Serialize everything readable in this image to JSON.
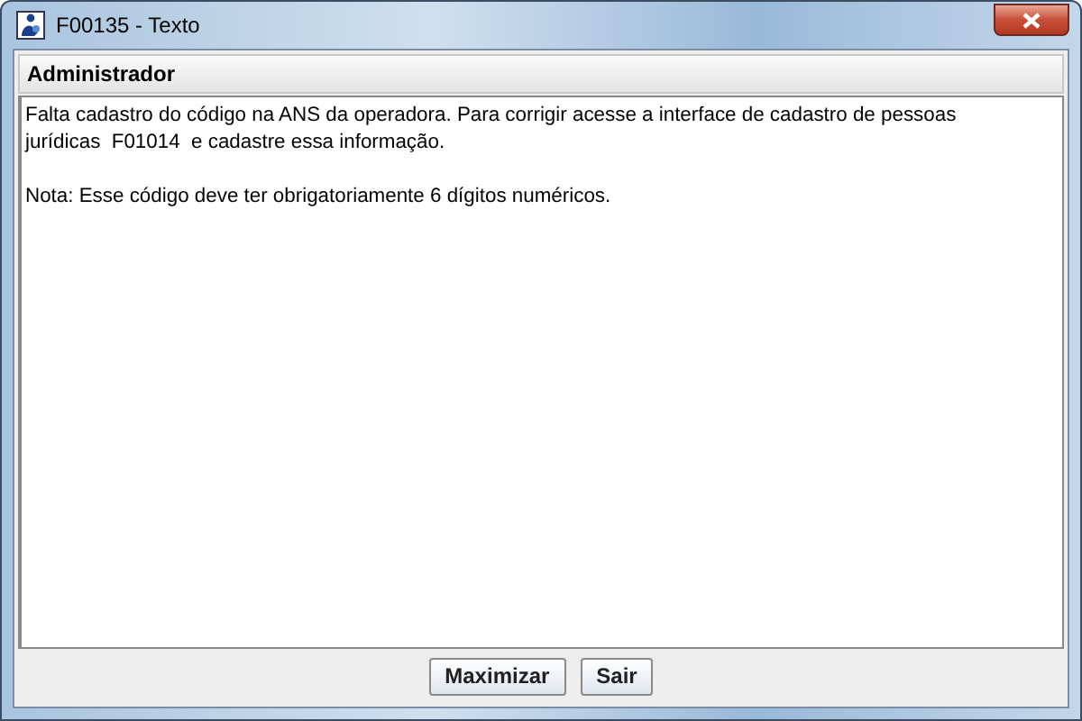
{
  "window": {
    "title": "F00135 - Texto"
  },
  "header": "Administrador",
  "message": {
    "paragraphs": [
      {
        "lines": [
          "Falta cadastro do código na ANS da operadora. Para corrigir acesse a interface de cadastro de pessoas",
          "jurídicas  F01014  e cadastre essa informação."
        ]
      },
      {
        "lines": [
          "Nota: Esse código deve ter obrigatoriamente 6 dígitos numéricos."
        ]
      }
    ]
  },
  "buttons": [
    "Maximizar",
    "Sair"
  ]
}
